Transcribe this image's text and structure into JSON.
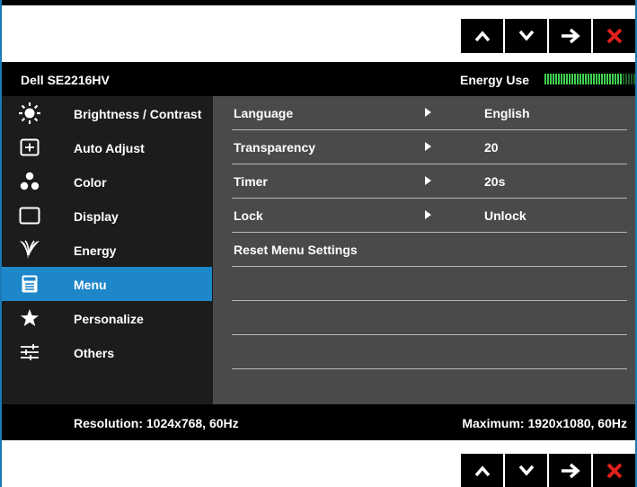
{
  "nav_buttons": [
    {
      "name": "up-button",
      "icon": "chevron-up-icon"
    },
    {
      "name": "down-button",
      "icon": "chevron-down-icon"
    },
    {
      "name": "enter-button",
      "icon": "arrow-right-icon"
    },
    {
      "name": "exit-button",
      "icon": "close-icon"
    }
  ],
  "header": {
    "model": "Dell SE2216HV",
    "energy_label": "Energy Use"
  },
  "energy_meter": {
    "level": 0.85,
    "on_color": "#3fd34f",
    "off_color": "#1f5d26"
  },
  "sidebar": {
    "items": [
      {
        "label": "Brightness / Contrast",
        "icon": "brightness-icon"
      },
      {
        "label": "Auto Adjust",
        "icon": "auto-adjust-icon"
      },
      {
        "label": "Color",
        "icon": "color-icon"
      },
      {
        "label": "Display",
        "icon": "display-icon"
      },
      {
        "label": "Energy",
        "icon": "energy-icon"
      },
      {
        "label": "Menu",
        "icon": "menu-icon",
        "active": true
      },
      {
        "label": "Personalize",
        "icon": "star-icon"
      },
      {
        "label": "Others",
        "icon": "sliders-icon"
      }
    ]
  },
  "menu": {
    "rows": [
      {
        "label": "Language",
        "value": "English"
      },
      {
        "label": "Transparency",
        "value": "20"
      },
      {
        "label": "Timer",
        "value": "20s"
      },
      {
        "label": "Lock",
        "value": "Unlock"
      },
      {
        "label": "Reset Menu Settings",
        "value": ""
      },
      {
        "label": "",
        "value": ""
      },
      {
        "label": "",
        "value": ""
      },
      {
        "label": "",
        "value": ""
      }
    ]
  },
  "footer": {
    "resolution": "Resolution: 1024x768, 60Hz",
    "maximum": "Maximum: 1920x1080, 60Hz"
  },
  "colors": {
    "accent": "#1e87c9",
    "exit": "#e0201b"
  }
}
